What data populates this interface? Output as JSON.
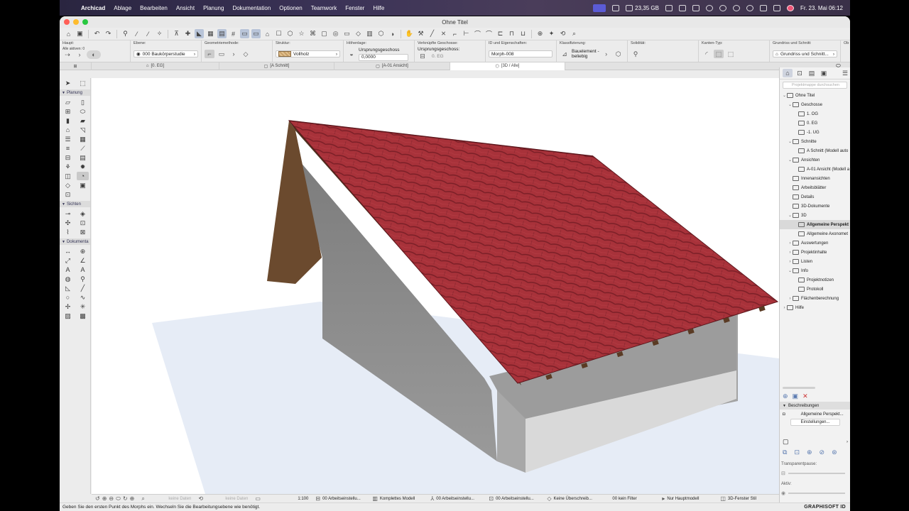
{
  "menubar": {
    "app": "Archicad",
    "items": [
      "Ablage",
      "Bearbeiten",
      "Ansicht",
      "Planung",
      "Dokumentation",
      "Optionen",
      "Teamwork",
      "Fenster",
      "Hilfe"
    ],
    "storage": "23,35 GB",
    "datetime": "Fr. 23. Mai 06:12"
  },
  "window": {
    "title": "Ohne Titel"
  },
  "infobox": {
    "haupt_label": "Haupt:",
    "alle_aktiven": "Alle aktiven: 0",
    "ebene_label": "Ebene:",
    "ebene_value": "000 Baukörperstudie",
    "geometrie_label": "Geometriemethode:",
    "struktur_label": "Struktur:",
    "struktur_value": "Vollholz",
    "hoehenlage_label": "Höhenlage:",
    "hoehenlage_ref": "Ursprungsgeschoss",
    "hoehenlage_value": "0,0000",
    "verknuepfte_label": "Verknüpfte Geschosse:",
    "verknuepfte_value": "Ursprungsgeschoss:",
    "verknuepfte_geschoss": "0. EG",
    "id_label": "ID und Eigenschaften:",
    "id_value": "Morph-008",
    "klass_label": "Klassifizierung:",
    "klass_value1": "Bauelement -",
    "klass_value2": "beliebig",
    "solid_label": "Solidität:",
    "kanten_label": "Kanten-Typ:",
    "grundriss_label": "Grundriss und Schnitt:",
    "grundriss_value": "Grundriss und Schnitt...",
    "ob_label": "Ob"
  },
  "tabs": [
    "[0. EG]",
    "[A Schnitt]",
    "[A-01 Ansicht]",
    "[3D / Alle]"
  ],
  "toolbox": {
    "planung": "Planung",
    "sichten": "Sichten",
    "dokumenta": "Dokumenta"
  },
  "navigator": {
    "search_placeholder": "Projektmappe durchsuchen",
    "tree": [
      {
        "label": "Ohne Titel",
        "level": 0,
        "arrow": "⌄"
      },
      {
        "label": "Geschosse",
        "level": 1,
        "arrow": "⌄"
      },
      {
        "label": "1. OG",
        "level": 2,
        "arrow": ""
      },
      {
        "label": "0. EG",
        "level": 2,
        "arrow": ""
      },
      {
        "label": "-1. UG",
        "level": 2,
        "arrow": ""
      },
      {
        "label": "Schnitte",
        "level": 1,
        "arrow": "⌄"
      },
      {
        "label": "A Schnitt (Modell auto",
        "level": 2,
        "arrow": ""
      },
      {
        "label": "Ansichten",
        "level": 1,
        "arrow": "⌄"
      },
      {
        "label": "A-01 Ansicht (Modell a",
        "level": 2,
        "arrow": ""
      },
      {
        "label": "Innenansichten",
        "level": 1,
        "arrow": ""
      },
      {
        "label": "Arbeitsblätter",
        "level": 1,
        "arrow": ""
      },
      {
        "label": "Details",
        "level": 1,
        "arrow": ""
      },
      {
        "label": "3D-Dokumente",
        "level": 1,
        "arrow": ""
      },
      {
        "label": "3D",
        "level": 1,
        "arrow": "⌄"
      },
      {
        "label": "Allgemeine Perspekt",
        "level": 2,
        "arrow": "",
        "selected": true
      },
      {
        "label": "Allgemeine Axonomet",
        "level": 2,
        "arrow": ""
      },
      {
        "label": "Auswertungen",
        "level": 1,
        "arrow": "›"
      },
      {
        "label": "Projektinhalte",
        "level": 1,
        "arrow": "›"
      },
      {
        "label": "Listen",
        "level": 1,
        "arrow": "›"
      },
      {
        "label": "Info",
        "level": 1,
        "arrow": "⌄"
      },
      {
        "label": "Projektnotizen",
        "level": 2,
        "arrow": ""
      },
      {
        "label": "Protokoll",
        "level": 2,
        "arrow": ""
      },
      {
        "label": "Flächenberechnung",
        "level": 1,
        "arrow": "›"
      },
      {
        "label": "Hilfe",
        "level": 0,
        "arrow": "›"
      }
    ],
    "beschreibungen": "Beschreibungen",
    "view_name": "Allgemeine Perspekt...",
    "einstellungen": "Einstellungen...",
    "transparentpause": "Transparentpause:",
    "aktiv": "Aktiv:"
  },
  "bottombar": {
    "keine_daten_1": "keine Daten",
    "keine_daten_2": "keine Daten",
    "scale": "1:100",
    "arbeit1": "00 Arbeitseinstellu...",
    "modell": "Komplettes Modell",
    "arbeit2": "00 Arbeitseinstellu...",
    "arbeit3": "00 Arbeitseinstellu...",
    "ueberschreib": "Keine Überschreib...",
    "filter": "00 kein Filter",
    "hauptmodell": "Nur Hauptmodell",
    "fensterstil": "3D-Fenster Stil"
  },
  "statusbar": {
    "message": "Geben Sie den ersten Punkt des Morphs ein. Wechseln Sie die Bearbeitungsebene wie benötigt.",
    "brand": "GRAPHISOFT ID"
  },
  "colors": {
    "roof": "#a8323a",
    "roof_dark": "#7a1f27",
    "fascia": "#6b4a2e",
    "wall_gable": "#8f8f8f",
    "wall_side": "#9d9d9d",
    "plinth": "#d8d8d8",
    "ground": "#e6ecf6"
  }
}
